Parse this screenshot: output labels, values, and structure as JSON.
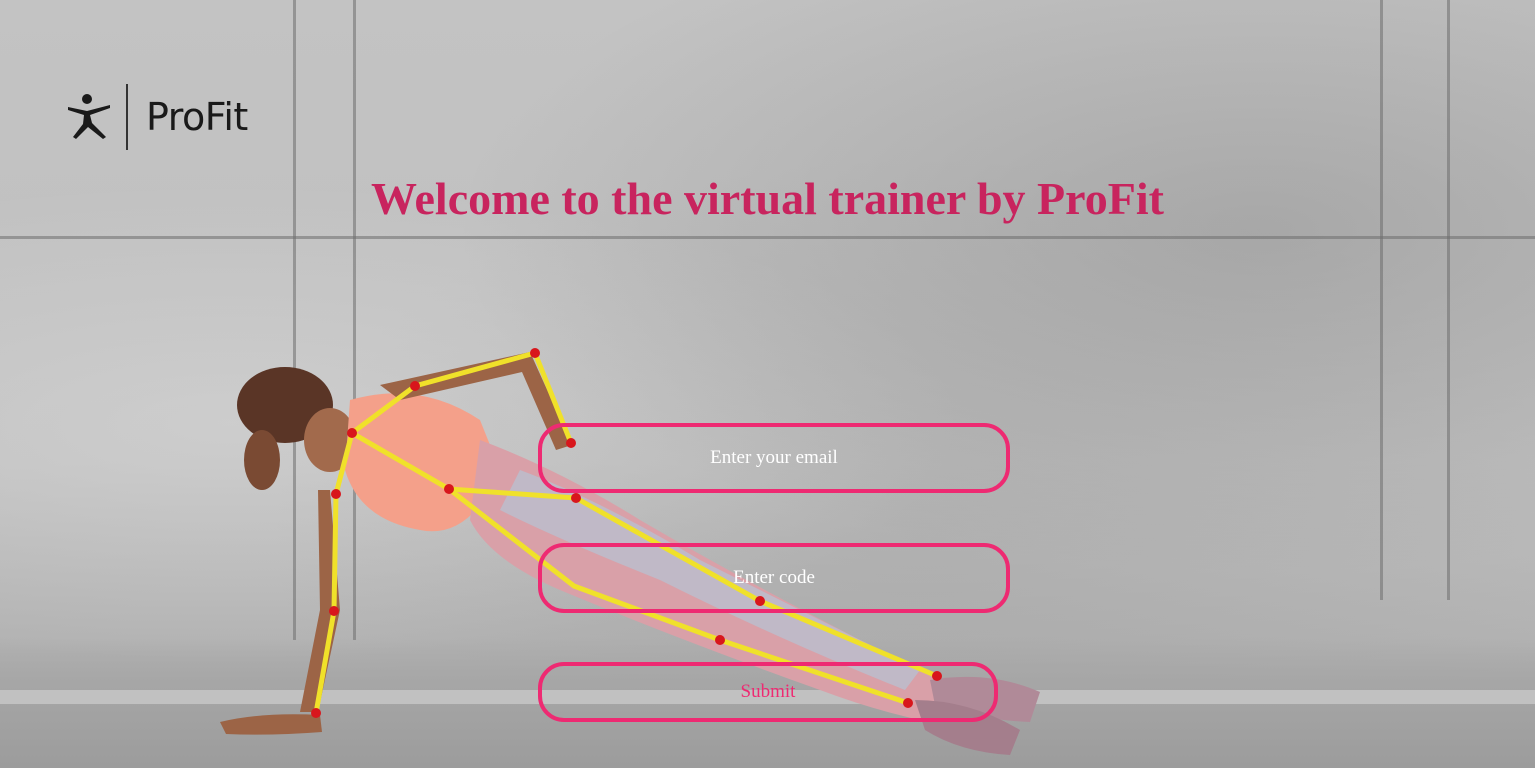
{
  "brand": {
    "name": "ProFit",
    "logo_icon": "yoga-pose-icon"
  },
  "heading": "Welcome to the virtual trainer by ProFit",
  "form": {
    "email_placeholder": "Enter your email",
    "code_placeholder": "Enter code",
    "submit_label": "Submit"
  },
  "colors": {
    "accent": "#ee2a72",
    "heading": "#c8245e",
    "skeleton_line": "#f0e12a",
    "skeleton_joint": "#d8161c"
  }
}
